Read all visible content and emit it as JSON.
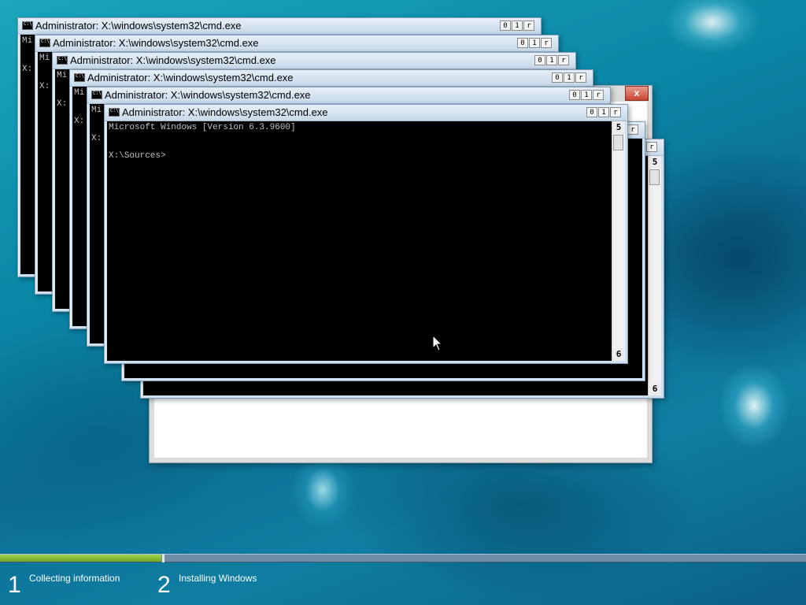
{
  "cmd": {
    "title": "Administrator: X:\\windows\\system32\\cmd.exe",
    "buttons": [
      "0",
      "1",
      "r"
    ],
    "line1": "Microsoft Windows [Version 6.3.9600]",
    "line2": "X:\\Sources>",
    "partial_line1": "Mi",
    "partial_line2": "X:",
    "scroll_up_glyph": "5",
    "scroll_down_glyph": "6",
    "close_glyph": "x"
  },
  "setup_steps": [
    {
      "number": "1",
      "label": "Collecting information"
    },
    {
      "number": "2",
      "label": "Installing Windows"
    }
  ],
  "progress": {
    "fraction": 0.2
  },
  "colors": {
    "progress_fill": "#8cc63f",
    "console_bg": "#000000",
    "console_text": "#c0c0c0"
  }
}
